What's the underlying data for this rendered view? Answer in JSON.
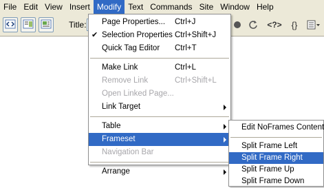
{
  "menubar": {
    "items": [
      "File",
      "Edit",
      "View",
      "Insert",
      "Modify",
      "Text",
      "Commands",
      "Site",
      "Window",
      "Help"
    ]
  },
  "toolbar": {
    "title_label": "Title:",
    "icons": [
      "code-view-icon",
      "split-view-icon",
      "design-view-icon",
      "refresh-icon",
      "tag-inspector-icon",
      "brackets-icon",
      "options-icon"
    ]
  },
  "modify_menu": {
    "page_properties": {
      "label": "Page Properties...",
      "shortcut": "Ctrl+J"
    },
    "selection_properties": {
      "label": "Selection Properties",
      "shortcut": "Ctrl+Shift+J",
      "checked": true
    },
    "quick_tag_editor": {
      "label": "Quick Tag Editor",
      "shortcut": "Ctrl+T"
    },
    "make_link": {
      "label": "Make Link",
      "shortcut": "Ctrl+L"
    },
    "remove_link": {
      "label": "Remove Link",
      "shortcut": "Ctrl+Shift+L"
    },
    "open_linked_page": {
      "label": "Open Linked Page..."
    },
    "link_target": {
      "label": "Link Target"
    },
    "table": {
      "label": "Table"
    },
    "frameset": {
      "label": "Frameset"
    },
    "navigation_bar": {
      "label": "Navigation Bar"
    },
    "arrange": {
      "label": "Arrange"
    }
  },
  "frameset_submenu": {
    "items": [
      "Edit NoFrames Content",
      "Split Frame Left",
      "Split Frame Right",
      "Split Frame Up",
      "Split Frame Down"
    ],
    "highlighted": "Split Frame Right"
  },
  "colors": {
    "highlight": "#316ac5",
    "menubar_bg": "#ece9d8",
    "disabled_text": "#a7a6aa"
  }
}
